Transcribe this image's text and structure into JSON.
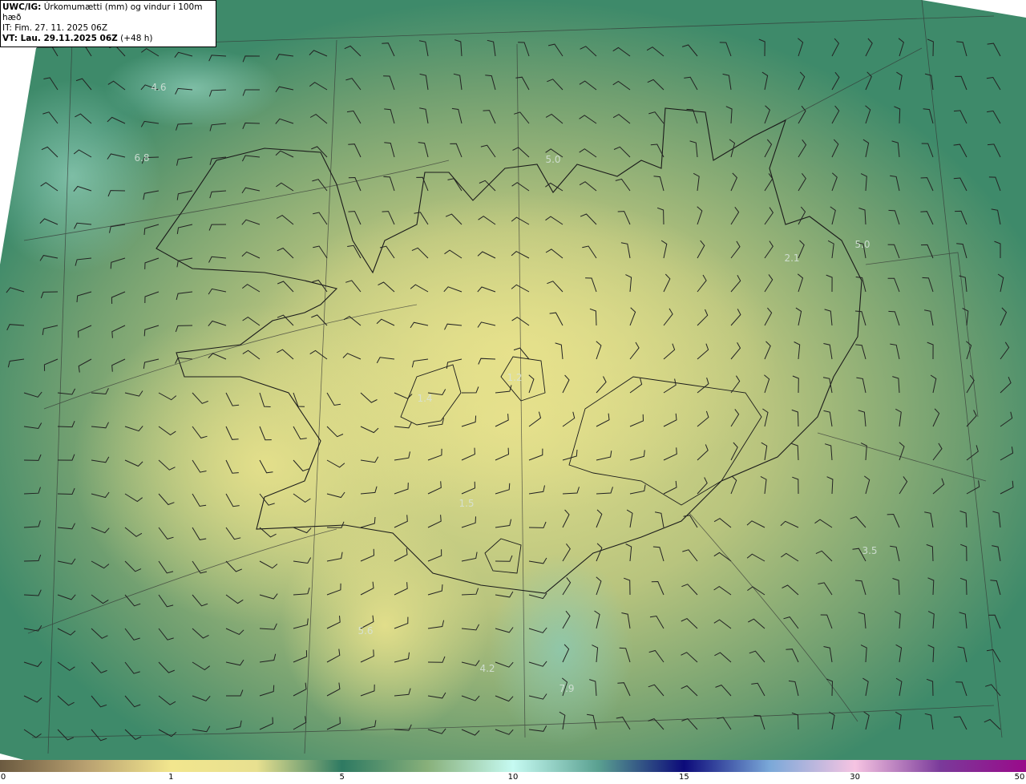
{
  "header": {
    "model_label": "UWC/IG:",
    "title": "Úrkomumætti (mm) og vindur i 100m hæð",
    "init_time": "IT: Fim. 27. 11. 2025 06Z",
    "valid_label": "VT: Lau. 29.11.2025 06Z",
    "lead": "(+48 h)"
  },
  "value_labels": [
    "4.6",
    "6.8",
    "5.0",
    "5.0",
    "2.1",
    "1.4",
    "1.2",
    "1.5",
    "3.5",
    "5.6",
    "4.2",
    "7.9"
  ],
  "colorbar": {
    "ticks": [
      "0",
      "1",
      "5",
      "10",
      "15",
      "30",
      "50"
    ],
    "stops": [
      {
        "value": "0",
        "color": "#6b5a40"
      },
      {
        "value": "1",
        "color": "#f2e68e"
      },
      {
        "value": "5",
        "color": "#2e7a62"
      },
      {
        "value": "10",
        "color": "#c6faf2"
      },
      {
        "value": "15",
        "color": "#0c0a7a"
      },
      {
        "value": "30",
        "color": "#f6c4e2"
      },
      {
        "value": "50",
        "color": "#9a0a8a"
      }
    ]
  },
  "colors": {
    "sea": "#3d8a6c",
    "land_low": "#e6e08a",
    "coastline": "#1a1a1a",
    "grid": "#333333"
  }
}
